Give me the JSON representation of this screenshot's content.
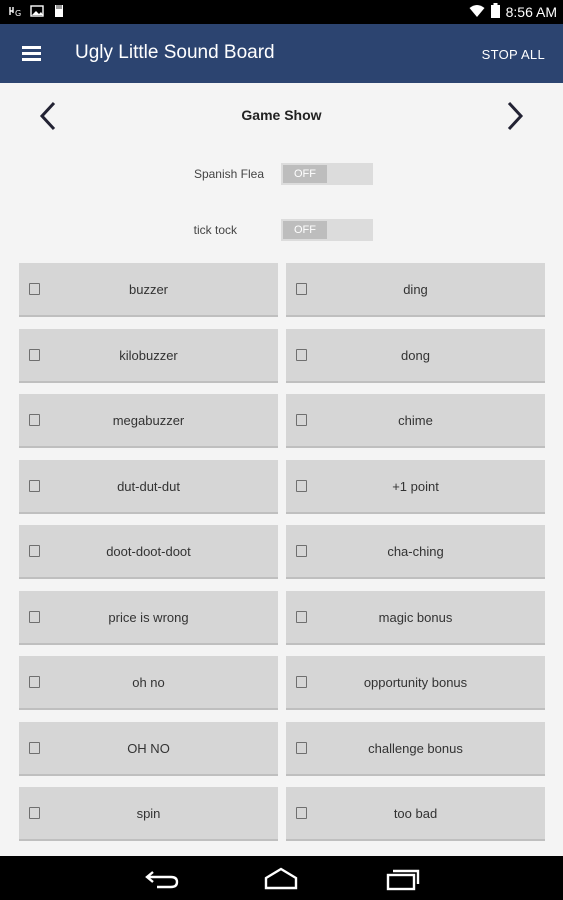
{
  "status_bar": {
    "time": "8:56 AM",
    "icons": [
      "signal-icon",
      "image-icon",
      "storage-icon",
      "wifi-icon",
      "battery-icon"
    ]
  },
  "app_bar": {
    "title": "Ugly Little Sound Board",
    "stop_all_label": "STOP ALL",
    "background": "#2c4470"
  },
  "board": {
    "title": "Game Show",
    "toggles": [
      {
        "label": "Spanish Flea",
        "state": "OFF"
      },
      {
        "label": "tick tock",
        "state": "OFF"
      }
    ]
  },
  "sounds": [
    {
      "label": "buzzer",
      "checked": false
    },
    {
      "label": "ding",
      "checked": false
    },
    {
      "label": "kilobuzzer",
      "checked": false
    },
    {
      "label": "dong",
      "checked": false
    },
    {
      "label": "megabuzzer",
      "checked": false
    },
    {
      "label": "chime",
      "checked": false
    },
    {
      "label": "dut-dut-dut",
      "checked": false
    },
    {
      "label": "+1 point",
      "checked": false
    },
    {
      "label": "doot-doot-doot",
      "checked": false
    },
    {
      "label": "cha-ching",
      "checked": false
    },
    {
      "label": "price is wrong",
      "checked": false
    },
    {
      "label": "magic bonus",
      "checked": false
    },
    {
      "label": "oh no",
      "checked": false
    },
    {
      "label": "opportunity bonus",
      "checked": false
    },
    {
      "label": "OH NO",
      "checked": false
    },
    {
      "label": "challenge bonus",
      "checked": false
    },
    {
      "label": "spin",
      "checked": false
    },
    {
      "label": "too bad",
      "checked": false
    }
  ]
}
